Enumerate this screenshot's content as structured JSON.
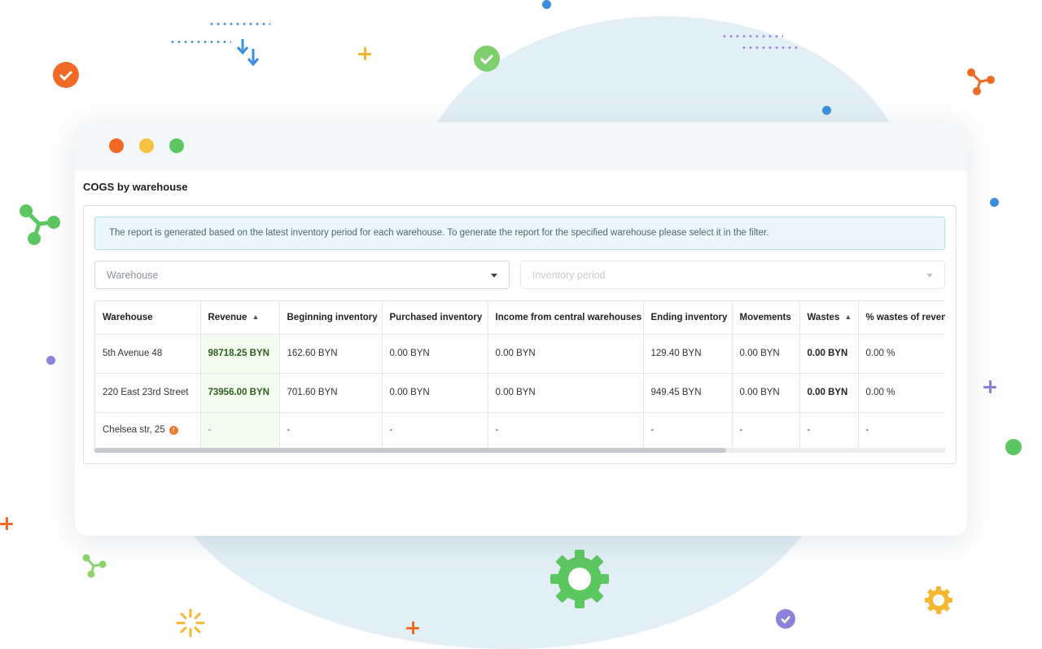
{
  "colors": {
    "accent_green": "#5cc761",
    "accent_orange": "#f06a25",
    "accent_blue": "#3b8fd8",
    "accent_purple": "#8b82d9",
    "revenue_bg": "#f4fbef",
    "alert_bg": "#ebf7fa"
  },
  "window": {
    "traffic_lights": [
      "close",
      "minimize",
      "maximize"
    ]
  },
  "report": {
    "title": "COGS by warehouse",
    "notice": "The report is generated based on the latest inventory period for each warehouse. To generate the report for the specified warehouse please select it in the filter.",
    "filters": {
      "warehouse_placeholder": "Warehouse",
      "period_placeholder": "Inventory period"
    },
    "table": {
      "columns": [
        "Warehouse",
        "Revenue",
        "Beginning inventory",
        "Purchased inventory",
        "Income from central warehouses",
        "Ending inventory",
        "Movements",
        "Wastes",
        "% wastes of revenue"
      ],
      "rows": [
        {
          "warehouse": "5th Avenue 48",
          "revenue": "98718.25 BYN",
          "beginning": "162.60 BYN",
          "purchased": "0.00 BYN",
          "income_central": "0.00 BYN",
          "ending": "129.40 BYN",
          "movements": "0.00 BYN",
          "wastes": "0.00 BYN",
          "wastes_pct": "0.00 %"
        },
        {
          "warehouse": "220 East 23rd Street",
          "revenue": "73956.00 BYN",
          "beginning": "701.60 BYN",
          "purchased": "0.00 BYN",
          "income_central": "0.00 BYN",
          "ending": "949.45 BYN",
          "movements": "0.00 BYN",
          "wastes": "0.00 BYN",
          "wastes_pct": "0.00 %"
        },
        {
          "warehouse": "Chelsea str, 25",
          "revenue": "-",
          "beginning": "-",
          "purchased": "-",
          "income_central": "-",
          "ending": "-",
          "movements": "-",
          "wastes": "-",
          "wastes_pct": "-"
        }
      ],
      "warning_icon": "!"
    }
  },
  "decorations": {
    "icons": [
      "check-icon",
      "network-icon",
      "gear-icon",
      "plus-icon",
      "arrow-down-icon",
      "sparkle-icon"
    ]
  }
}
